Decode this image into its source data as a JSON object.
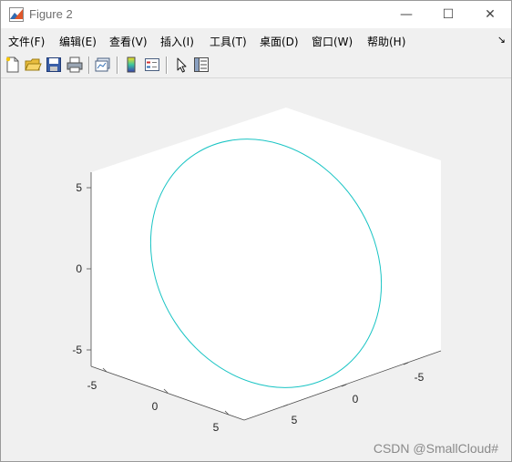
{
  "window": {
    "title": "Figure 2",
    "minimize_glyph": "—",
    "maximize_glyph": "☐",
    "close_glyph": "✕"
  },
  "menu": {
    "items": [
      "文件(F)",
      "编辑(E)",
      "查看(V)",
      "插入(I)",
      "工具(T)",
      "桌面(D)",
      "窗口(W)",
      "帮助(H)"
    ],
    "overflow_glyph": "↘"
  },
  "toolbar": {
    "buttons": [
      "new-figure-icon",
      "open-file-icon",
      "save-icon",
      "print-icon",
      "link-plot-icon",
      "insert-colorbar-icon",
      "insert-legend-icon",
      "pointer-icon",
      "property-inspector-icon"
    ]
  },
  "plot": {
    "z_ticks": [
      "5",
      "0",
      "-5"
    ],
    "x_ticks": [
      "-5",
      "0",
      "5"
    ],
    "y_ticks": [
      "5",
      "0",
      "-5"
    ],
    "line_color": "#19c4c4",
    "axes_background": "#ffffff",
    "figure_background": "#f0f0f0"
  },
  "watermark": "CSDN @SmallCloud#"
}
